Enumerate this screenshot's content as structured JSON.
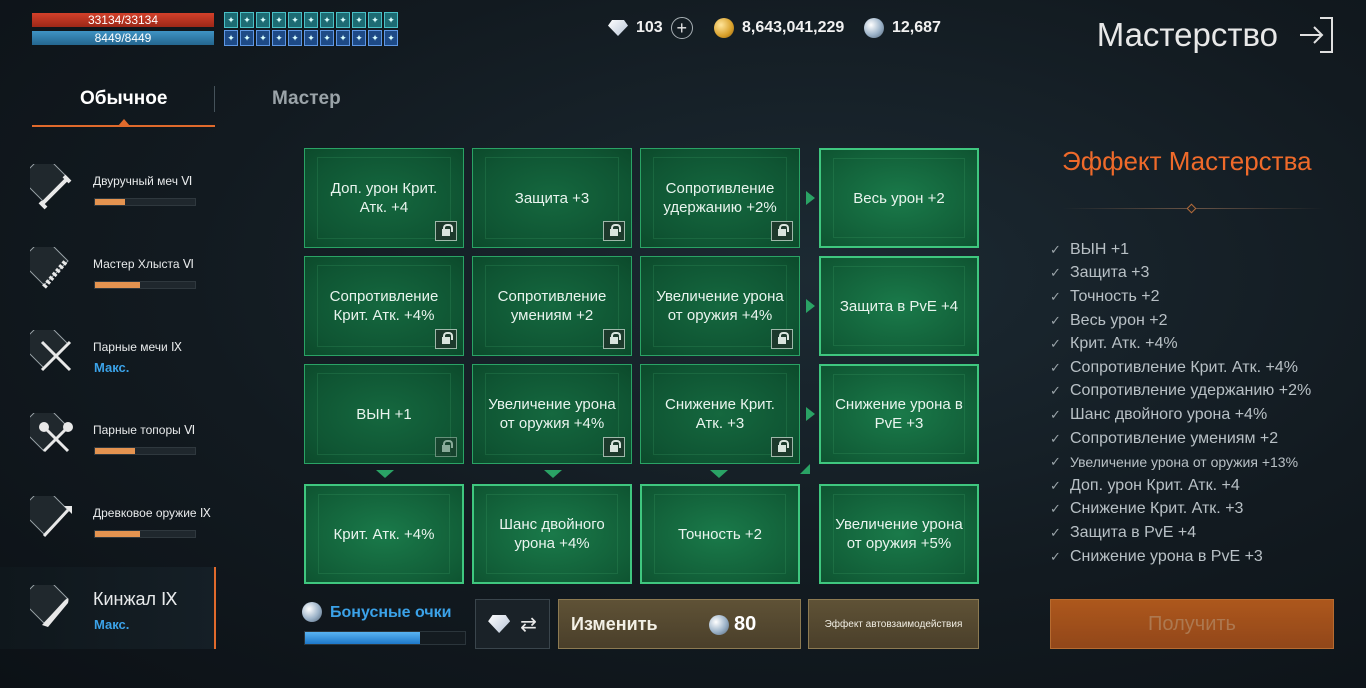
{
  "status": {
    "hp": "33134/33134",
    "mp": "8449/8449",
    "hp_color": "#d3402a",
    "mp_color": "#3f93c4",
    "buff_icons": [
      "buff-icon",
      "buff-icon",
      "buff-icon",
      "buff-icon",
      "buff-icon",
      "buff-icon",
      "buff-icon",
      "buff-icon",
      "buff-icon",
      "buff-icon",
      "buff-icon",
      "buff-icon",
      "buff-icon",
      "buff-icon",
      "buff-icon",
      "buff-icon",
      "buff-icon",
      "buff-icon",
      "buff-icon",
      "buff-icon",
      "buff-icon",
      "buff-icon"
    ]
  },
  "currency": {
    "diamonds": "103",
    "gold": "8,643,041,229",
    "orbs": "12,687"
  },
  "header": {
    "title": "Мастерство"
  },
  "tabs": [
    {
      "label": "Обычное",
      "active": true
    },
    {
      "label": "Мастер",
      "active": false
    }
  ],
  "weapons": [
    {
      "name": "Двуручный меч Ⅵ",
      "progress": 0.3,
      "max_label": null,
      "icon": "two-handed-sword-icon"
    },
    {
      "name": "Мастер Хлыста Ⅵ",
      "progress": 0.45,
      "max_label": null,
      "icon": "whip-icon"
    },
    {
      "name": "Парные мечи Ⅸ",
      "progress": null,
      "max_label": "Макс.",
      "icon": "dual-swords-icon"
    },
    {
      "name": "Парные топоры Ⅵ",
      "progress": 0.4,
      "max_label": null,
      "icon": "dual-axes-icon"
    },
    {
      "name": "Древковое оружие Ⅸ",
      "progress": 0.45,
      "max_label": null,
      "icon": "polearm-icon"
    },
    {
      "name": "Кинжал Ⅸ",
      "progress": null,
      "max_label": "Макс.",
      "icon": "dagger-icon",
      "active": true
    }
  ],
  "grid": {
    "cells": [
      {
        "text": "Доп. урон Крит. Атк. +4",
        "lock": true
      },
      {
        "text": "Защита +3",
        "lock": true
      },
      {
        "text": "Сопротивление удержанию +2%",
        "lock": true
      },
      {
        "text": "Весь урон +2",
        "lock": false
      },
      {
        "text": "Сопротивление Крит. Атк. +4%",
        "lock": true
      },
      {
        "text": "Сопротивление умениям +2",
        "lock": true
      },
      {
        "text": "Увеличение урона от оружия +4%",
        "lock": true
      },
      {
        "text": "Защита в PvE +4",
        "lock": false
      },
      {
        "text": "ВЫН +1",
        "lock": "open"
      },
      {
        "text": "Увеличение урона от оружия +4%",
        "lock": true
      },
      {
        "text": "Снижение Крит. Атк. +3",
        "lock": true
      },
      {
        "text": "Снижение урона в PvE +3",
        "lock": false
      },
      {
        "text": "Крит. Атк. +4%",
        "lock": false
      },
      {
        "text": "Шанс двойного урона +4%",
        "lock": false
      },
      {
        "text": "Точность +2",
        "lock": false
      },
      {
        "text": "Увеличение урона от оружия +5%",
        "lock": false
      }
    ],
    "accent_color": "#2aa365"
  },
  "effects": {
    "title": "Эффект Мастерства",
    "title_color": "#ef6a2a",
    "items": [
      "ВЫН +1",
      "Защита +3",
      "Точность +2",
      "Весь урон +2",
      "Крит. Атк. +4%",
      "Сопротивление Крит. Атк. +4%",
      "Сопротивление удержанию  +2%",
      "Шанс двойного урона +4%",
      "Сопротивление умениям +2",
      "Увеличение урона от оружия +13%",
      "Доп. урон Крит. Атк. +4",
      "Снижение Крит. Атк. +3",
      "Защита в PvE +4",
      "Снижение урона в PvE +3"
    ]
  },
  "bottom": {
    "bonus_label": "Бонусные очки",
    "bonus_progress": 0.72,
    "change_label": "Изменить",
    "change_cost": "80",
    "auto_label": "Эффект автовзаимодействия",
    "get_label": "Получить"
  }
}
